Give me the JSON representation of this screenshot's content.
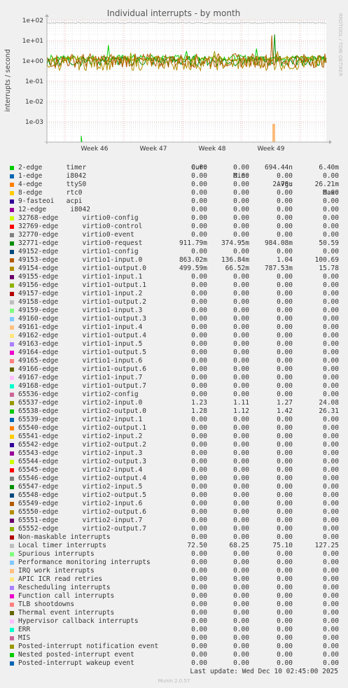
{
  "chart_data": {
    "type": "line",
    "title": "Individual interrupts - by month",
    "ylabel": "interrupts / second",
    "side_label": "RRDTOOL / TOBI OETIKER",
    "yscale": "log",
    "ylim": [
      0.0001,
      100
    ],
    "y_ticks": [
      "1e+02",
      "1e+01",
      "1e+00",
      "1e-01",
      "1e-02",
      "1e-03"
    ],
    "x_ticks": [
      "Week 46",
      "Week 47",
      "Week 48",
      "Week 49"
    ],
    "grid": true,
    "legend_placement": "bottom",
    "columns": [
      "Cur:",
      "Min:",
      "Avg:",
      "Max:"
    ],
    "series": [
      {
        "name": "2-edge      timer",
        "color": "#00cc00",
        "cur": "0.00",
        "min": "0.00",
        "avg": "694.44n",
        "max": "6.40m"
      },
      {
        "name": "1-edge      i8042",
        "color": "#0066b3",
        "cur": "0.00",
        "min": "0.00",
        "avg": "0.00",
        "max": "0.00"
      },
      {
        "name": "4-edge      ttyS0",
        "color": "#ff8000",
        "cur": "0.00",
        "min": "0.00",
        "avg": "2.78u",
        "max": "26.21m"
      },
      {
        "name": "8-edge      rtc0",
        "color": "#ffcc00",
        "cur": "0.00",
        "min": "0.00",
        "avg": "0.00",
        "max": "0.00"
      },
      {
        "name": "9-fasteoi   acpi",
        "color": "#330099",
        "cur": "0.00",
        "min": "0.00",
        "avg": "0.00",
        "max": "0.00"
      },
      {
        "name": "12-edge      i8042",
        "color": "#990099",
        "cur": "0.00",
        "min": "0.00",
        "avg": "0.00",
        "max": "0.00"
      },
      {
        "name": "32768-edge      virtio0-config",
        "color": "#ccff00",
        "cur": "0.00",
        "min": "0.00",
        "avg": "0.00",
        "max": "0.00"
      },
      {
        "name": "32769-edge      virtio0-control",
        "color": "#ff0000",
        "cur": "0.00",
        "min": "0.00",
        "avg": "0.00",
        "max": "0.00"
      },
      {
        "name": "32770-edge      virtio0-event",
        "color": "#808080",
        "cur": "0.00",
        "min": "0.00",
        "avg": "0.00",
        "max": "0.00"
      },
      {
        "name": "32771-edge      virtio0-request",
        "color": "#008f00",
        "cur": "911.79m",
        "min": "374.95m",
        "avg": "984.08m",
        "max": "50.59"
      },
      {
        "name": "49152-edge      virtio1-config",
        "color": "#00487d",
        "cur": "0.00",
        "min": "0.00",
        "avg": "0.00",
        "max": "0.00"
      },
      {
        "name": "49153-edge      virtio1-input.0",
        "color": "#b35a00",
        "cur": "863.02m",
        "min": "136.84m",
        "avg": "1.04",
        "max": "100.69"
      },
      {
        "name": "49154-edge      virtio1-output.0",
        "color": "#b38f00",
        "cur": "499.59m",
        "min": "66.52m",
        "avg": "787.53m",
        "max": "15.78"
      },
      {
        "name": "49155-edge      virtio1-input.1",
        "color": "#6b006b",
        "cur": "0.00",
        "min": "0.00",
        "avg": "0.00",
        "max": "0.00"
      },
      {
        "name": "49156-edge      virtio1-output.1",
        "color": "#8fb300",
        "cur": "0.00",
        "min": "0.00",
        "avg": "0.00",
        "max": "0.00"
      },
      {
        "name": "49157-edge      virtio1-input.2",
        "color": "#b30000",
        "cur": "0.00",
        "min": "0.00",
        "avg": "0.00",
        "max": "0.00"
      },
      {
        "name": "49158-edge      virtio1-output.2",
        "color": "#bebebe",
        "cur": "0.00",
        "min": "0.00",
        "avg": "0.00",
        "max": "0.00"
      },
      {
        "name": "49159-edge      virtio1-input.3",
        "color": "#80ff80",
        "cur": "0.00",
        "min": "0.00",
        "avg": "0.00",
        "max": "0.00"
      },
      {
        "name": "49160-edge      virtio1-output.3",
        "color": "#80c9ff",
        "cur": "0.00",
        "min": "0.00",
        "avg": "0.00",
        "max": "0.00"
      },
      {
        "name": "49161-edge      virtio1-input.4",
        "color": "#ffc080",
        "cur": "0.00",
        "min": "0.00",
        "avg": "0.00",
        "max": "0.00"
      },
      {
        "name": "49162-edge      virtio1-output.4",
        "color": "#ffe680",
        "cur": "0.00",
        "min": "0.00",
        "avg": "0.00",
        "max": "0.00"
      },
      {
        "name": "49163-edge      virtio1-input.5",
        "color": "#aa80ff",
        "cur": "0.00",
        "min": "0.00",
        "avg": "0.00",
        "max": "0.00"
      },
      {
        "name": "49164-edge      virtio1-output.5",
        "color": "#ee00cc",
        "cur": "0.00",
        "min": "0.00",
        "avg": "0.00",
        "max": "0.00"
      },
      {
        "name": "49165-edge      virtio1-input.6",
        "color": "#ff8080",
        "cur": "0.00",
        "min": "0.00",
        "avg": "0.00",
        "max": "0.00"
      },
      {
        "name": "49166-edge      virtio1-output.6",
        "color": "#666600",
        "cur": "0.00",
        "min": "0.00",
        "avg": "0.00",
        "max": "0.00"
      },
      {
        "name": "49167-edge      virtio1-input.7",
        "color": "#ffbfff",
        "cur": "0.00",
        "min": "0.00",
        "avg": "0.00",
        "max": "0.00"
      },
      {
        "name": "49168-edge      virtio1-output.7",
        "color": "#00ffcc",
        "cur": "0.00",
        "min": "0.00",
        "avg": "0.00",
        "max": "0.00"
      },
      {
        "name": "65536-edge      virtio2-config",
        "color": "#cc6699",
        "cur": "0.00",
        "min": "0.00",
        "avg": "0.00",
        "max": "0.00"
      },
      {
        "name": "65537-edge      virtio2-input.0",
        "color": "#999900",
        "cur": "1.23",
        "min": "1.11",
        "avg": "1.27",
        "max": "24.08"
      },
      {
        "name": "65538-edge      virtio2-output.0",
        "color": "#00cc00",
        "cur": "1.28",
        "min": "1.12",
        "avg": "1.42",
        "max": "26.31"
      },
      {
        "name": "65539-edge      virtio2-input.1",
        "color": "#0066b3",
        "cur": "0.00",
        "min": "0.00",
        "avg": "0.00",
        "max": "0.00"
      },
      {
        "name": "65540-edge      virtio2-output.1",
        "color": "#ff8000",
        "cur": "0.00",
        "min": "0.00",
        "avg": "0.00",
        "max": "0.00"
      },
      {
        "name": "65541-edge      virtio2-input.2",
        "color": "#ffcc00",
        "cur": "0.00",
        "min": "0.00",
        "avg": "0.00",
        "max": "0.00"
      },
      {
        "name": "65542-edge      virtio2-output.2",
        "color": "#330099",
        "cur": "0.00",
        "min": "0.00",
        "avg": "0.00",
        "max": "0.00"
      },
      {
        "name": "65543-edge      virtio2-input.3",
        "color": "#990099",
        "cur": "0.00",
        "min": "0.00",
        "avg": "0.00",
        "max": "0.00"
      },
      {
        "name": "65544-edge      virtio2-output.3",
        "color": "#ccff00",
        "cur": "0.00",
        "min": "0.00",
        "avg": "0.00",
        "max": "0.00"
      },
      {
        "name": "65545-edge      virtio2-input.4",
        "color": "#ff0000",
        "cur": "0.00",
        "min": "0.00",
        "avg": "0.00",
        "max": "0.00"
      },
      {
        "name": "65546-edge      virtio2-output.4",
        "color": "#808080",
        "cur": "0.00",
        "min": "0.00",
        "avg": "0.00",
        "max": "0.00"
      },
      {
        "name": "65547-edge      virtio2-input.5",
        "color": "#008f00",
        "cur": "0.00",
        "min": "0.00",
        "avg": "0.00",
        "max": "0.00"
      },
      {
        "name": "65548-edge      virtio2-output.5",
        "color": "#00487d",
        "cur": "0.00",
        "min": "0.00",
        "avg": "0.00",
        "max": "0.00"
      },
      {
        "name": "65549-edge      virtio2-input.6",
        "color": "#b35a00",
        "cur": "0.00",
        "min": "0.00",
        "avg": "0.00",
        "max": "0.00"
      },
      {
        "name": "65550-edge      virtio2-output.6",
        "color": "#b38f00",
        "cur": "0.00",
        "min": "0.00",
        "avg": "0.00",
        "max": "0.00"
      },
      {
        "name": "65551-edge      virtio2-input.7",
        "color": "#6b006b",
        "cur": "0.00",
        "min": "0.00",
        "avg": "0.00",
        "max": "0.00"
      },
      {
        "name": "65552-edge      virtio2-output.7",
        "color": "#8fb300",
        "cur": "0.00",
        "min": "0.00",
        "avg": "0.00",
        "max": "0.00"
      },
      {
        "name": "Non-maskable interrupts",
        "color": "#b30000",
        "cur": "0.00",
        "min": "0.00",
        "avg": "0.00",
        "max": "0.00"
      },
      {
        "name": "Local timer interrupts",
        "color": "#bebebe",
        "cur": "72.50",
        "min": "68.25",
        "avg": "75.10",
        "max": "127.25"
      },
      {
        "name": "Spurious interrupts",
        "color": "#80ff80",
        "cur": "0.00",
        "min": "0.00",
        "avg": "0.00",
        "max": "0.00"
      },
      {
        "name": "Performance monitoring interrupts",
        "color": "#80c9ff",
        "cur": "0.00",
        "min": "0.00",
        "avg": "0.00",
        "max": "0.00"
      },
      {
        "name": "IRQ work interrupts",
        "color": "#ffc080",
        "cur": "0.00",
        "min": "0.00",
        "avg": "0.00",
        "max": "0.00"
      },
      {
        "name": "APIC ICR read retries",
        "color": "#ffe680",
        "cur": "0.00",
        "min": "0.00",
        "avg": "0.00",
        "max": "0.00"
      },
      {
        "name": "Rescheduling interrupts",
        "color": "#aa80ff",
        "cur": "0.00",
        "min": "0.00",
        "avg": "0.00",
        "max": "0.00"
      },
      {
        "name": "Function call interrupts",
        "color": "#ee00cc",
        "cur": "0.00",
        "min": "0.00",
        "avg": "0.00",
        "max": "0.00"
      },
      {
        "name": "TLB shootdowns",
        "color": "#ff8080",
        "cur": "0.00",
        "min": "0.00",
        "avg": "0.00",
        "max": "0.00"
      },
      {
        "name": "Thermal event interrupts",
        "color": "#666600",
        "cur": "0.00",
        "min": "0.00",
        "avg": "0.00",
        "max": "0.00"
      },
      {
        "name": "Hypervisor callback interrupts",
        "color": "#ffbfff",
        "cur": "0.00",
        "min": "0.00",
        "avg": "0.00",
        "max": "0.00"
      },
      {
        "name": "ERR",
        "color": "#00ffcc",
        "cur": "0.00",
        "min": "0.00",
        "avg": "0.00",
        "max": "0.00"
      },
      {
        "name": "MIS",
        "color": "#cc6699",
        "cur": "0.00",
        "min": "0.00",
        "avg": "0.00",
        "max": "0.00"
      },
      {
        "name": "Posted-interrupt notification event",
        "color": "#999900",
        "cur": "0.00",
        "min": "0.00",
        "avg": "0.00",
        "max": "0.00"
      },
      {
        "name": "Nested posted-interrupt event",
        "color": "#00cc00",
        "cur": "0.00",
        "min": "0.00",
        "avg": "0.00",
        "max": "0.00"
      },
      {
        "name": "Posted-interrupt wakeup event",
        "color": "#0066b3",
        "cur": "0.00",
        "min": "0.00",
        "avg": "0.00",
        "max": "0.00"
      }
    ]
  },
  "footer": {
    "last_update": "Last update: Wed Dec 10 02:45:00 2025",
    "munin_version": "Munin 2.0.57"
  }
}
